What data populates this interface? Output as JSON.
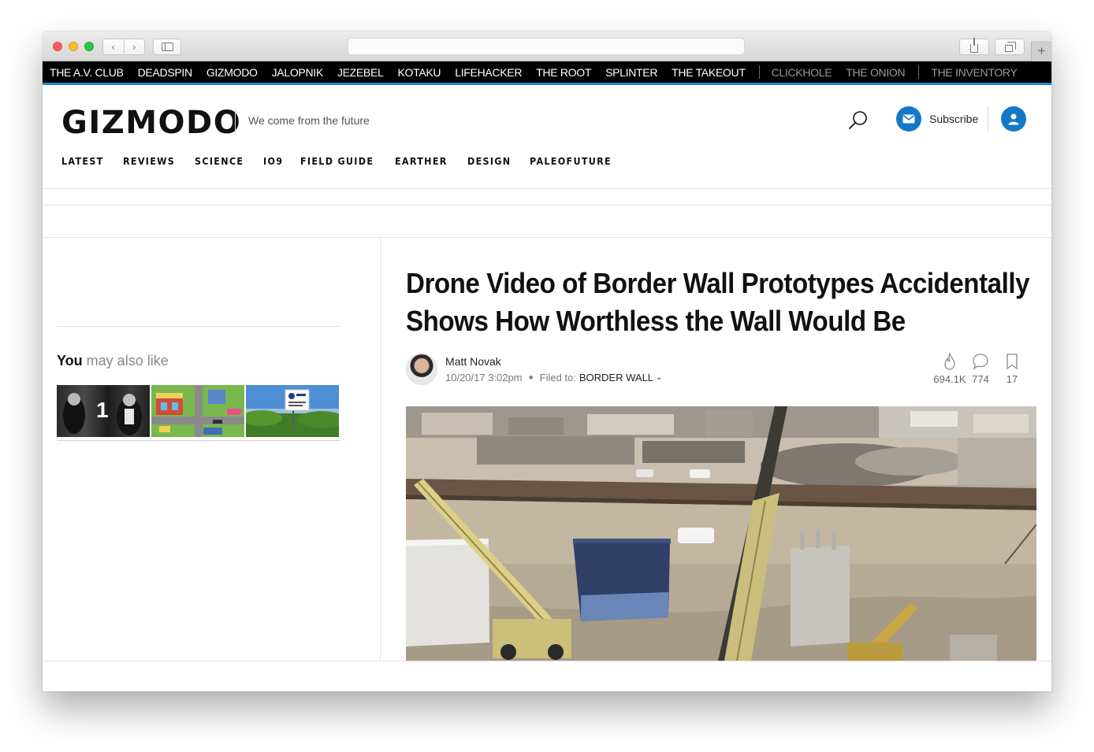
{
  "network": {
    "primary": [
      "THE A.V. CLUB",
      "DEADSPIN",
      "GIZMODO",
      "JALOPNIK",
      "JEZEBEL",
      "KOTAKU",
      "LIFEHACKER",
      "THE ROOT",
      "SPLINTER",
      "THE TAKEOUT"
    ],
    "partners": [
      "CLICKHOLE",
      "THE ONION"
    ],
    "shop": [
      "THE INVENTORY"
    ]
  },
  "header": {
    "logo": "GIZMODO",
    "tagline": "We come from the future",
    "subscribe_label": "Subscribe",
    "categories": [
      "LATEST",
      "REVIEWS",
      "SCIENCE",
      "IO9",
      "FIELD GUIDE",
      "EARTHER",
      "DESIGN",
      "PALEOFUTURE"
    ]
  },
  "sidebar": {
    "maylike_bold": "You",
    "maylike_rest": " may also like",
    "thumb1_badge": "1"
  },
  "article": {
    "headline_line1": "Drone Video of Border Wall Prototypes Accidentally",
    "headline_line2": "Shows How Worthless the Wall Would Be",
    "author": "Matt Novak",
    "timestamp": "10/20/17 3:02pm",
    "filed_label": "Filed to:",
    "filed_tag": "BORDER WALL",
    "views": "694.1K",
    "comments": "774",
    "bookmarks": "17"
  },
  "icons": {
    "search": "search-icon",
    "mail": "mail-icon",
    "account": "user-icon",
    "views": "flame-icon",
    "comments": "comment-bubble-icon",
    "bookmark": "bookmark-icon"
  },
  "colors": {
    "accent": "#1477c8",
    "network_border": "#1f8ad1"
  }
}
